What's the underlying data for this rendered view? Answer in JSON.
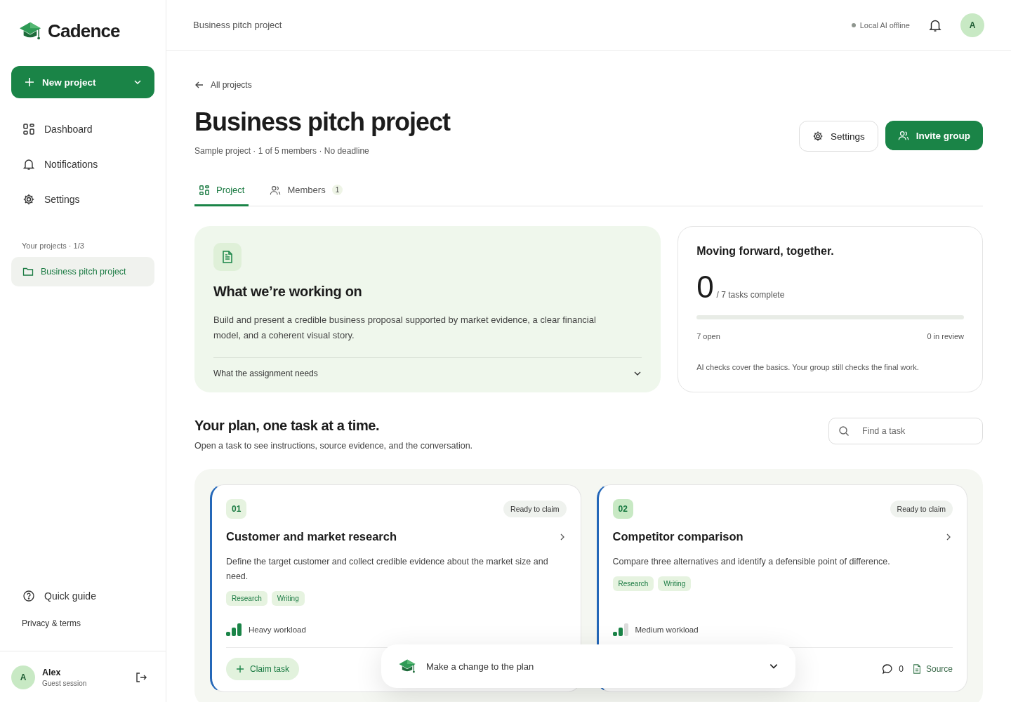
{
  "brand": {
    "name": "Cadence"
  },
  "new_project_button": {
    "label": "New project"
  },
  "nav": [
    {
      "label": "Dashboard",
      "kind": "dashboard",
      "selected": false
    },
    {
      "label": "Notifications",
      "kind": "bell",
      "selected": false
    },
    {
      "label": "Settings",
      "kind": "gear",
      "selected": false
    }
  ],
  "projects": {
    "heading": "Your projects · 1/3",
    "items": [
      {
        "label": "Business pitch project",
        "selected": true
      }
    ]
  },
  "footer_links": [
    {
      "label": "Quick guide",
      "kind": "help"
    },
    {
      "label": "Privacy & terms",
      "kind": "plain"
    }
  ],
  "user": {
    "initial": "A",
    "name": "Alex",
    "session": "Guest session"
  },
  "header": {
    "breadcrumb": "Business pitch project",
    "ai_status": "Local AI offline",
    "ai_online": false,
    "avatar": "A"
  },
  "page": {
    "back_link": "All projects",
    "title": "Business pitch project",
    "meta": "Sample project · 1 of 5 members · No deadline",
    "settings_button": "Settings",
    "invite_button": "Invite group"
  },
  "tabs": [
    {
      "label": "Project",
      "kind": "grid",
      "selected": true
    },
    {
      "label": "Members",
      "kind": "people",
      "badge": "1",
      "selected": false
    }
  ],
  "brief": {
    "title": "What we’re working on",
    "description": "Build and present a credible business proposal supported by market evidence, a clear financial model, and a coherent visual story.",
    "toggle": "What the assignment needs",
    "expanded": false
  },
  "progress": {
    "title": "Moving forward, together.",
    "done": "0",
    "total": "/ 7 tasks complete",
    "level": 0,
    "open": "7 open",
    "review": "0 in review",
    "note": "AI checks cover the basics. Your group still checks the final work."
  },
  "plan": {
    "title": "Your plan, one task at a time.",
    "subtitle": "Open a task to see instructions, source evidence, and the conversation.",
    "search_placeholder": "Find a task"
  },
  "tasks": [
    {
      "number": "01",
      "status": "Ready to claim",
      "title": "Customer and market research",
      "description": "Define the target customer and collect credible evidence about the market size and need.",
      "tags": [
        "Research",
        "Writing"
      ],
      "workload": "Heavy workload",
      "kind": "heavy",
      "claim_button": "Claim task"
    },
    {
      "number": "02",
      "status": "Ready to claim",
      "title": "Competitor comparison",
      "description": "Compare three alternatives and identify a defensible point of difference.",
      "tags": [
        "Research",
        "Writing"
      ],
      "workload": "Medium workload",
      "kind": "medium",
      "comments": "0",
      "source": "Source"
    }
  ],
  "assistant": {
    "label": "Make a change to the plan",
    "expanded": false
  }
}
